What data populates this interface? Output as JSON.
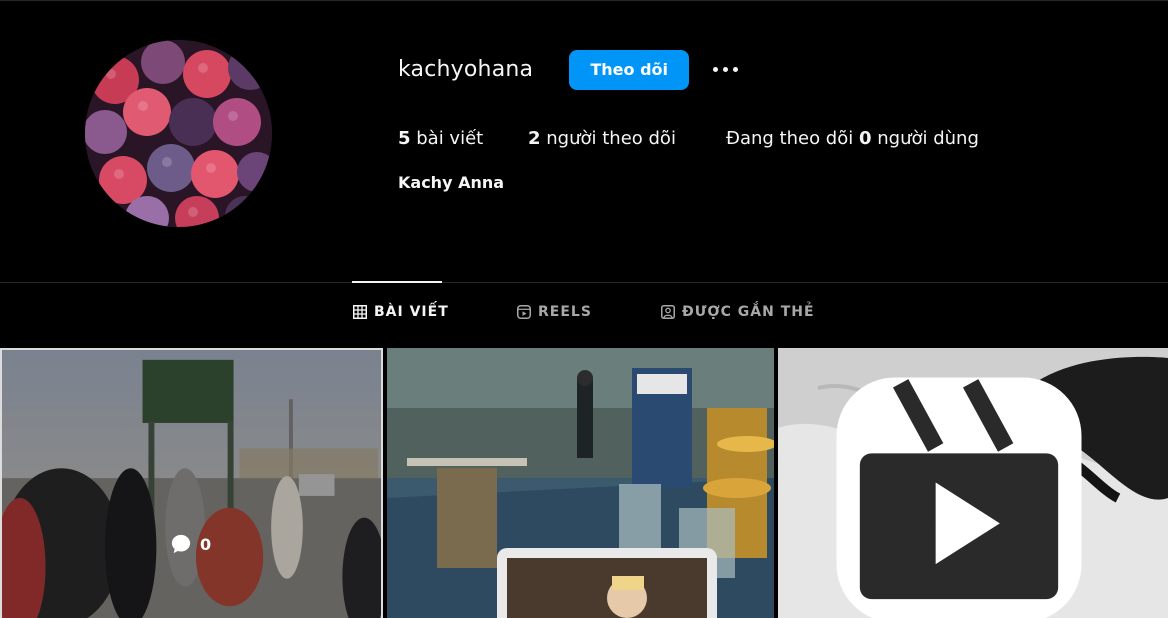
{
  "profile": {
    "username": "kachyohana",
    "follow_label": "Theo dõi",
    "more_icon": "more-horizontal-icon",
    "full_name": "Kachy Anna",
    "stats": {
      "posts_count": "5",
      "posts_label": " bài viết",
      "followers_count": "2",
      "followers_label": " người theo dõi",
      "following_prefix": "Đang theo dõi ",
      "following_count": "0",
      "following_suffix": " người dùng"
    }
  },
  "tabs": [
    {
      "label": "BÀI VIẾT",
      "icon": "grid-icon",
      "active": true
    },
    {
      "label": "REELS",
      "icon": "reels-icon",
      "active": false
    },
    {
      "label": "ĐƯỢC GẮN THẺ",
      "icon": "tagged-icon",
      "active": false
    }
  ],
  "posts": [
    {
      "comments": "0",
      "hovered": true
    },
    {
      "hovered": false
    },
    {
      "is_reel": true,
      "icon": "reel-badge-icon"
    }
  ],
  "colors": {
    "background": "#000000",
    "accent": "#0095f6",
    "text": "#f5f5f5",
    "muted": "#a8a8a8",
    "divider": "#262626"
  }
}
